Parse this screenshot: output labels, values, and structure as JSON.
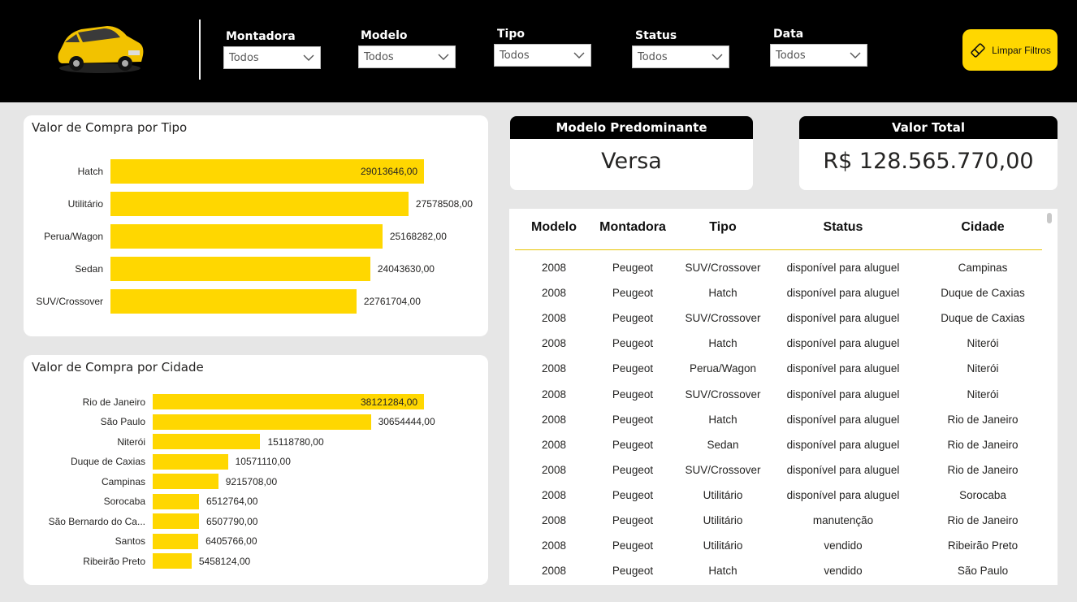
{
  "header": {
    "filters": [
      {
        "label": "Montadora",
        "value": "Todos"
      },
      {
        "label": "Modelo",
        "value": "Todos"
      },
      {
        "label": "Tipo",
        "value": "Todos"
      },
      {
        "label": "Status",
        "value": "Todos"
      },
      {
        "label": "Data",
        "value": "Todos"
      }
    ],
    "clear_button": "Limpar Filtros"
  },
  "colors": {
    "accent": "#ffd700",
    "header_bg": "#000000",
    "page_bg": "#e6e6e6"
  },
  "chart_tipo": {
    "title": "Valor de Compra por Tipo",
    "chart_data": {
      "type": "bar",
      "orientation": "horizontal",
      "categories": [
        "Hatch",
        "Utilitário",
        "Perua/Wagon",
        "Sedan",
        "SUV/Crossover"
      ],
      "values": [
        29013646.0,
        27578508.0,
        25168282.0,
        24043630.0,
        22761704.0
      ],
      "labels": [
        "29013646,00",
        "27578508,00",
        "25168282,00",
        "24043630,00",
        "22761704,00"
      ]
    }
  },
  "chart_cidade": {
    "title": "Valor de Compra por Cidade",
    "chart_data": {
      "type": "bar",
      "orientation": "horizontal",
      "categories": [
        "Rio de Janeiro",
        "São Paulo",
        "Niterói",
        "Duque de Caxias",
        "Campinas",
        "Sorocaba",
        "São Bernardo do Ca...",
        "Santos",
        "Ribeirão Preto"
      ],
      "values": [
        38121284.0,
        30654444.0,
        15118780.0,
        10571110.0,
        9215708.0,
        6512764.0,
        6507790.0,
        6405766.0,
        5458124.0
      ],
      "labels": [
        "38121284,00",
        "30654444,00",
        "15118780,00",
        "10571110,00",
        "9215708,00",
        "6512764,00",
        "6507790,00",
        "6405766,00",
        "5458124,00"
      ]
    }
  },
  "kpi_modelo": {
    "title": "Modelo Predominante",
    "value": "Versa"
  },
  "kpi_total": {
    "title": "Valor Total",
    "value": "R$ 128.565.770,00"
  },
  "table": {
    "columns": [
      "Modelo",
      "Montadora",
      "Tipo",
      "Status",
      "Cidade"
    ],
    "rows": [
      [
        "2008",
        "Peugeot",
        "SUV/Crossover",
        "disponível para aluguel",
        "Campinas"
      ],
      [
        "2008",
        "Peugeot",
        "Hatch",
        "disponível para aluguel",
        "Duque de Caxias"
      ],
      [
        "2008",
        "Peugeot",
        "SUV/Crossover",
        "disponível para aluguel",
        "Duque de Caxias"
      ],
      [
        "2008",
        "Peugeot",
        "Hatch",
        "disponível para aluguel",
        "Niterói"
      ],
      [
        "2008",
        "Peugeot",
        "Perua/Wagon",
        "disponível para aluguel",
        "Niterói"
      ],
      [
        "2008",
        "Peugeot",
        "SUV/Crossover",
        "disponível para aluguel",
        "Niterói"
      ],
      [
        "2008",
        "Peugeot",
        "Hatch",
        "disponível para aluguel",
        "Rio de Janeiro"
      ],
      [
        "2008",
        "Peugeot",
        "Sedan",
        "disponível para aluguel",
        "Rio de Janeiro"
      ],
      [
        "2008",
        "Peugeot",
        "SUV/Crossover",
        "disponível para aluguel",
        "Rio de Janeiro"
      ],
      [
        "2008",
        "Peugeot",
        "Utilitário",
        "disponível para aluguel",
        "Sorocaba"
      ],
      [
        "2008",
        "Peugeot",
        "Utilitário",
        "manutenção",
        "Rio de Janeiro"
      ],
      [
        "2008",
        "Peugeot",
        "Utilitário",
        "vendido",
        "Ribeirão Preto"
      ],
      [
        "2008",
        "Peugeot",
        "Hatch",
        "vendido",
        "São Paulo"
      ]
    ]
  }
}
